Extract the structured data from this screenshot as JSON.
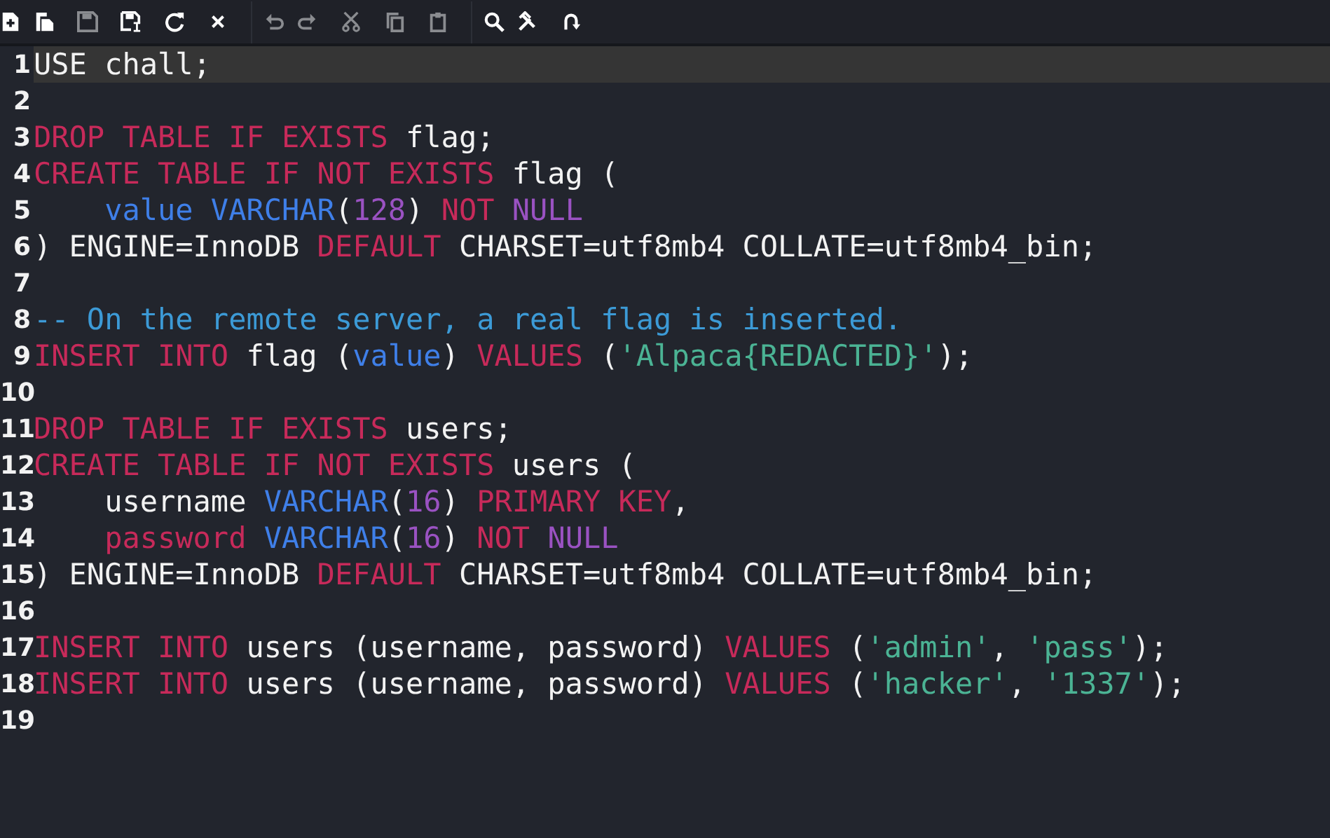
{
  "toolbar": {
    "groups": [
      [
        {
          "kind": "new",
          "disabled": false
        },
        {
          "kind": "open",
          "disabled": false
        },
        {
          "kind": "save",
          "disabled": true
        },
        {
          "kind": "save-as",
          "disabled": false
        },
        {
          "kind": "reload",
          "disabled": false
        },
        {
          "kind": "close",
          "disabled": false
        }
      ],
      [
        {
          "kind": "undo",
          "disabled": true
        },
        {
          "kind": "redo",
          "disabled": true
        },
        {
          "kind": "cut",
          "disabled": true
        },
        {
          "kind": "copy",
          "disabled": true
        },
        {
          "kind": "paste",
          "disabled": true
        }
      ],
      [
        {
          "kind": "search",
          "disabled": false
        },
        {
          "kind": "replace",
          "disabled": false
        },
        {
          "kind": "goto",
          "disabled": false
        }
      ]
    ]
  },
  "editor": {
    "lines": [
      {
        "number": "1",
        "current": true,
        "tokens": [
          {
            "kind": "plain",
            "text": "USE chall;"
          }
        ]
      },
      {
        "number": "2",
        "current": false
      },
      {
        "number": "3",
        "current": false,
        "tokens": [
          {
            "kind": "keyword",
            "text": "DROP TABLE IF EXISTS"
          },
          {
            "kind": "plain",
            "text": " flag;"
          }
        ]
      },
      {
        "number": "4",
        "current": false,
        "tokens": [
          {
            "kind": "keyword",
            "text": "CREATE TABLE IF NOT EXISTS"
          },
          {
            "kind": "plain",
            "text": " flag ("
          }
        ]
      },
      {
        "number": "5",
        "current": false,
        "indent": true,
        "tokens": [
          {
            "kind": "identifier",
            "text": "value"
          },
          {
            "kind": "type",
            "text": " VARCHAR"
          },
          {
            "kind": "plain",
            "text": "("
          },
          {
            "kind": "number",
            "text": "128"
          },
          {
            "kind": "plain",
            "text": ") "
          },
          {
            "kind": "keyword",
            "text": "NOT"
          },
          {
            "kind": "constant",
            "text": " NULL"
          }
        ]
      },
      {
        "number": "6",
        "current": false,
        "tokens": [
          {
            "kind": "plain",
            "text": ") ENGINE=InnoDB "
          },
          {
            "kind": "keyword",
            "text": "DEFAULT"
          },
          {
            "kind": "plain",
            "text": " CHARSET=utf8mb4 COLLATE=utf8mb4_bin;"
          }
        ]
      },
      {
        "number": "7",
        "current": false
      },
      {
        "number": "8",
        "current": false,
        "tokens": [
          {
            "kind": "comment",
            "text": "-- On the remote server, a real flag is inserted."
          }
        ]
      },
      {
        "number": "9",
        "current": false,
        "tokens": [
          {
            "kind": "keyword",
            "text": "INSERT INTO"
          },
          {
            "kind": "plain",
            "text": " flag ("
          },
          {
            "kind": "identifier",
            "text": "value"
          },
          {
            "kind": "plain",
            "text": ") "
          },
          {
            "kind": "keyword",
            "text": "VALUES"
          },
          {
            "kind": "plain",
            "text": " ("
          },
          {
            "kind": "string",
            "text": "'Alpaca{REDACTED}'"
          },
          {
            "kind": "plain",
            "text": ");"
          }
        ]
      },
      {
        "number": "10",
        "current": false
      },
      {
        "number": "11",
        "current": false,
        "tokens": [
          {
            "kind": "keyword",
            "text": "DROP TABLE IF EXISTS"
          },
          {
            "kind": "plain",
            "text": " users;"
          }
        ]
      },
      {
        "number": "12",
        "current": false,
        "tokens": [
          {
            "kind": "keyword",
            "text": "CREATE TABLE IF NOT EXISTS"
          },
          {
            "kind": "plain",
            "text": " users ("
          }
        ]
      },
      {
        "number": "13",
        "current": false,
        "indent": true,
        "tokens": [
          {
            "kind": "plain",
            "text": "username "
          },
          {
            "kind": "type",
            "text": "VARCHAR"
          },
          {
            "kind": "plain",
            "text": "("
          },
          {
            "kind": "number",
            "text": "16"
          },
          {
            "kind": "plain",
            "text": ") "
          },
          {
            "kind": "keyword",
            "text": "PRIMARY KEY"
          },
          {
            "kind": "plain",
            "text": ","
          }
        ]
      },
      {
        "number": "14",
        "current": false,
        "indent": true,
        "tokens": [
          {
            "kind": "keyword",
            "text": "password"
          },
          {
            "kind": "type",
            "text": " VARCHAR"
          },
          {
            "kind": "plain",
            "text": "("
          },
          {
            "kind": "number",
            "text": "16"
          },
          {
            "kind": "plain",
            "text": ") "
          },
          {
            "kind": "keyword",
            "text": "NOT"
          },
          {
            "kind": "constant",
            "text": " NULL"
          }
        ]
      },
      {
        "number": "15",
        "current": false,
        "tokens": [
          {
            "kind": "plain",
            "text": ") ENGINE=InnoDB "
          },
          {
            "kind": "keyword",
            "text": "DEFAULT"
          },
          {
            "kind": "plain",
            "text": " CHARSET=utf8mb4 COLLATE=utf8mb4_bin;"
          }
        ]
      },
      {
        "number": "16",
        "current": false
      },
      {
        "number": "17",
        "current": false,
        "tokens": [
          {
            "kind": "keyword",
            "text": "INSERT INTO"
          },
          {
            "kind": "plain",
            "text": " users (username, password) "
          },
          {
            "kind": "keyword",
            "text": "VALUES"
          },
          {
            "kind": "plain",
            "text": " ("
          },
          {
            "kind": "string",
            "text": "'admin'"
          },
          {
            "kind": "plain",
            "text": ", "
          },
          {
            "kind": "string",
            "text": "'pass'"
          },
          {
            "kind": "plain",
            "text": ");"
          }
        ]
      },
      {
        "number": "18",
        "current": false,
        "tokens": [
          {
            "kind": "keyword",
            "text": "INSERT INTO"
          },
          {
            "kind": "plain",
            "text": " users (username, password) "
          },
          {
            "kind": "keyword",
            "text": "VALUES"
          },
          {
            "kind": "plain",
            "text": " ("
          },
          {
            "kind": "string",
            "text": "'hacker'"
          },
          {
            "kind": "plain",
            "text": ", "
          },
          {
            "kind": "string",
            "text": "'1337'"
          },
          {
            "kind": "plain",
            "text": ");"
          }
        ]
      },
      {
        "number": "19",
        "current": false
      }
    ]
  }
}
